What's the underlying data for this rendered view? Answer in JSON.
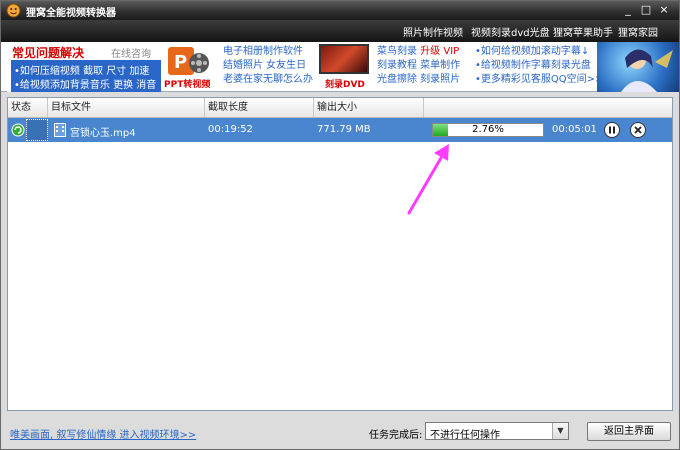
{
  "window": {
    "title": "狸窝全能视频转换器",
    "controls": [
      "_",
      "□",
      "×"
    ]
  },
  "top_menu": [
    "照片制作视频",
    "视频刻录dvd光盘",
    "狸窝苹果助手",
    "狸窝家园"
  ],
  "banner": {
    "faq_title": "常见问题解决",
    "faq_online": "在线咨询",
    "faq_link_1": "•如何压缩视频  截取  尺寸  加速",
    "faq_link_2": "•给视频添加背景音乐  更换  消音",
    "ppt_label": "PPT转视频",
    "col1": [
      "电子相册制作软件",
      "结婚照片  女友生日",
      "老婆在家无聊怎么办"
    ],
    "dvd_label": "刻录DVD",
    "col2_line1_a": "菜鸟刻录",
    "col2_line1_b": "升级 VIP",
    "col2_line2": "刻录教程  菜单制作",
    "col2_line3": "光盘擦除  刻录照片",
    "col3": [
      "•如何给视频加滚动字幕↓",
      "•给视频制作字幕刻录光盘",
      "•更多精彩见客服QQ空间>>"
    ]
  },
  "list": {
    "headers": [
      "状态",
      "目标文件",
      "截取长度",
      "输出大小",
      ""
    ],
    "rows": [
      {
        "file": "宫锁心玉.mp4",
        "duration": "00:19:52",
        "size": "771.79 MB",
        "progress_text": "2.76%",
        "progress": 0.0276,
        "remaining": "00:05:01"
      }
    ]
  },
  "bottom": {
    "link": "唯美画面, 叙写修仙情缘 进入视频环境>>",
    "after_label": "任务完成后:",
    "after_select": "不进行任何操作",
    "main_button": "返回主界面"
  },
  "colors": {
    "selected_row": "#4a86cf",
    "progress_green": "#22a822",
    "annotation_arrow": "#ff3cff",
    "link_blue": "#2a66c8",
    "red": "#d60000"
  },
  "icons": [
    "app-icon",
    "status-icon",
    "video-file-icon",
    "pause-icon",
    "remove-icon",
    "dropdown-arrow-icon"
  ]
}
